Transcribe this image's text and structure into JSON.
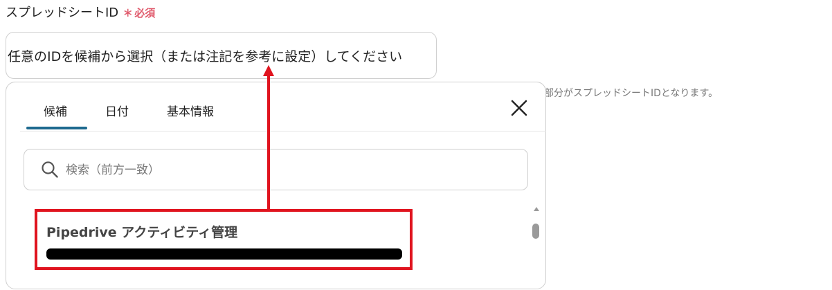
{
  "field": {
    "label": "スプレッドシートID",
    "required_mark": "∗",
    "required_text": "必須",
    "input_placeholder": "任意のIDを候補から選択（または注記を参考に設定）してください"
  },
  "note_fragment": "部分がスプレッドシートIDとなります。",
  "dropdown": {
    "tabs": [
      {
        "label": "候補",
        "active": true
      },
      {
        "label": "日付",
        "active": false
      },
      {
        "label": "基本情報",
        "active": false
      }
    ],
    "search_placeholder": "検索（前方一致）",
    "items": [
      {
        "title": "Pipedrive アクティビティ管理"
      }
    ]
  },
  "colors": {
    "required": "#e05a6c",
    "tab_indicator": "#1e6a8f",
    "annotation": "#e0141f"
  },
  "icons": [
    "close-icon",
    "search-icon",
    "scroll-up-icon"
  ]
}
